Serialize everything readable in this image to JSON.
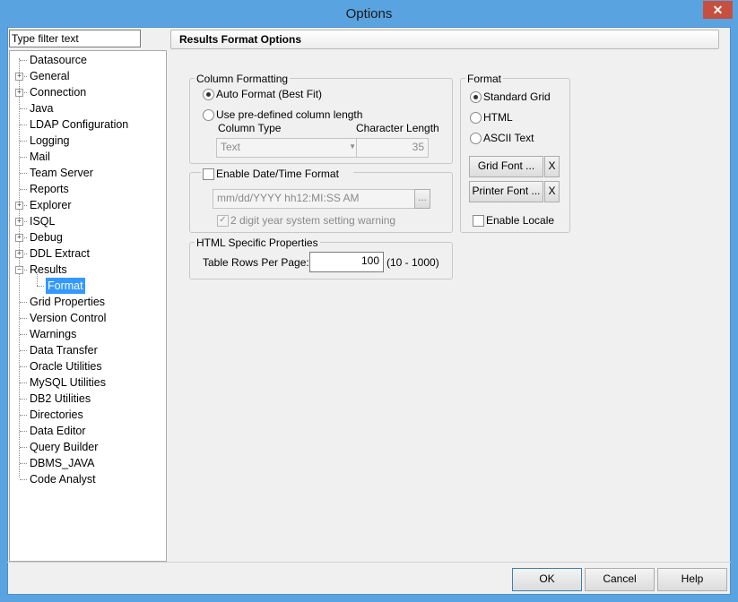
{
  "window": {
    "title": "Options",
    "close_label": "✕"
  },
  "filter": {
    "placeholder": "Type filter text",
    "value": "Type filter text"
  },
  "tree": {
    "items": [
      {
        "label": "Datasource",
        "expandable": false
      },
      {
        "label": "General",
        "expandable": true
      },
      {
        "label": "Connection",
        "expandable": true
      },
      {
        "label": "Java",
        "expandable": false
      },
      {
        "label": "LDAP Configuration",
        "expandable": false
      },
      {
        "label": "Logging",
        "expandable": false
      },
      {
        "label": "Mail",
        "expandable": false
      },
      {
        "label": "Team Server",
        "expandable": false
      },
      {
        "label": "Reports",
        "expandable": false
      },
      {
        "label": "Explorer",
        "expandable": true
      },
      {
        "label": "ISQL",
        "expandable": true
      },
      {
        "label": "Debug",
        "expandable": true
      },
      {
        "label": "DDL Extract",
        "expandable": true
      },
      {
        "label": "Results",
        "expandable": true,
        "expanded": true
      },
      {
        "label": "Format",
        "child": true,
        "selected": true
      },
      {
        "label": "Grid Properties",
        "expandable": false
      },
      {
        "label": "Version Control",
        "expandable": false
      },
      {
        "label": "Warnings",
        "expandable": false
      },
      {
        "label": "Data Transfer",
        "expandable": false
      },
      {
        "label": "Oracle Utilities",
        "expandable": false
      },
      {
        "label": "MySQL Utilities",
        "expandable": false
      },
      {
        "label": "DB2 Utilities",
        "expandable": false
      },
      {
        "label": "Directories",
        "expandable": false
      },
      {
        "label": "Data Editor",
        "expandable": false
      },
      {
        "label": "Query Builder",
        "expandable": false
      },
      {
        "label": "DBMS_JAVA",
        "expandable": false
      },
      {
        "label": "Code Analyst",
        "expandable": false
      }
    ]
  },
  "panel": {
    "header": "Results Format Options",
    "column_formatting": {
      "legend": "Column Formatting",
      "auto_format_label": "Auto Format (Best Fit)",
      "auto_format_checked": true,
      "predefined_label": "Use pre-defined column length",
      "predefined_checked": false,
      "column_type_label": "Column Type",
      "column_type_value": "Text",
      "char_length_label": "Character Length",
      "char_length_value": "35"
    },
    "datetime": {
      "enable_label": "Enable Date/Time Format",
      "enabled": false,
      "format_value": "mm/dd/YYYY hh12:MI:SS AM",
      "browse_label": "...",
      "two_digit_label": "2 digit year system setting warning",
      "two_digit_checked": true
    },
    "html_props": {
      "legend": "HTML Specific Properties",
      "rows_label": "Table Rows Per Page:",
      "rows_value": "100",
      "rows_range": "(10 - 1000)"
    },
    "format": {
      "legend": "Format",
      "options": [
        "Standard Grid",
        "HTML",
        "ASCII Text"
      ],
      "selected_index": 0,
      "grid_font_label": "Grid Font ...",
      "printer_font_label": "Printer Font ...",
      "clear_label": "X",
      "locale_label": "Enable Locale",
      "locale_checked": false
    }
  },
  "footer": {
    "ok": "OK",
    "cancel": "Cancel",
    "help": "Help"
  },
  "colors": {
    "titlebar": "#59a4e0",
    "selection": "#3399ff",
    "close": "#c74f3f"
  }
}
